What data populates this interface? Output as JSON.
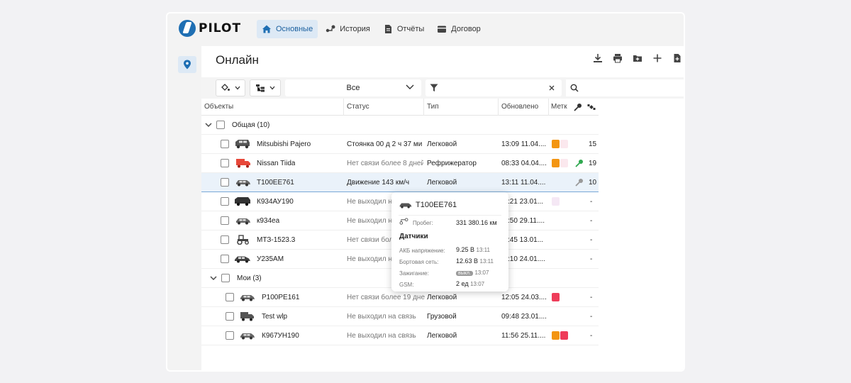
{
  "app": {
    "logo_text": "PILOT"
  },
  "nav": [
    {
      "label": "Основные",
      "icon": "home-icon",
      "active": true
    },
    {
      "label": "История",
      "icon": "route-icon",
      "active": false
    },
    {
      "label": "Отчёты",
      "icon": "report-icon",
      "active": false
    },
    {
      "label": "Договор",
      "icon": "wallet-icon",
      "active": false
    }
  ],
  "page": {
    "title": "Онлайн"
  },
  "filters": {
    "status_select": "Все",
    "accent": "#1f6fb3"
  },
  "table": {
    "headers": [
      "Объекты",
      "Статус",
      "Тип",
      "Обновлено",
      "Метк"
    ],
    "groups": [
      {
        "label": "Общая (10)"
      },
      {
        "label": "Мои (3)"
      }
    ],
    "rows": [
      {
        "name": "Mitsubishi Pajero",
        "status": "Стоянка 00 д 2 ч 37 ми",
        "type": "Легковой",
        "updated": "13:09 11.04....",
        "extra": "15"
      },
      {
        "name": "Nissan Tiida",
        "status": "Нет связи более 8 дней",
        "type": "Рефрижератор",
        "updated": "08:33 04.04....",
        "extra": "19"
      },
      {
        "name": "Т100ЕЕ761",
        "status": "Движение 143 км/ч",
        "type": "Легковой",
        "updated": "13:11 11.04....",
        "extra": "10"
      },
      {
        "name": "К934АУ190",
        "status": "Не выходил на",
        "type": "",
        "updated": ":21 23.01...",
        "extra": "-"
      },
      {
        "name": "к934еа",
        "status": "Не выходил на",
        "type": "",
        "updated": ":50 29.11....",
        "extra": "-"
      },
      {
        "name": "МТЗ-1523.3",
        "status": "Нет связи боле",
        "type": "",
        "updated": ":45 13.01...",
        "extra": "-"
      },
      {
        "name": "У235АМ",
        "status": "Не выходил на",
        "type": "",
        "updated": ":10 24.01....",
        "extra": "-"
      },
      {
        "name": "Р100РЕ161",
        "status": "Нет связи более 19 дне",
        "type": "Легковой",
        "updated": "12:05 24.03....",
        "extra": "-"
      },
      {
        "name": "Test wlp",
        "status": "Не выходил на связь",
        "type": "Грузовой",
        "updated": "09:48 23.01....",
        "extra": "-"
      },
      {
        "name": "К967УН190",
        "status": "Не выходил на связь",
        "type": "Легковой",
        "updated": "11:56 25.11....",
        "extra": "-"
      }
    ]
  },
  "tooltip": {
    "title": "Т100ЕЕ761",
    "mileage_label": "Пробег:",
    "mileage_value": "331 380.16 км",
    "section": "Датчики",
    "sensors": [
      {
        "label": "АКБ напряжение:",
        "value": "9.25 В",
        "time": "13:11"
      },
      {
        "label": "Бортовая сеть:",
        "value": "12.63 В",
        "time": "13:11"
      },
      {
        "label": "Зажигание:",
        "value": "выкл.",
        "time": "13:07"
      },
      {
        "label": "GSM:",
        "value": "2 ед",
        "time": "13:07"
      }
    ]
  }
}
